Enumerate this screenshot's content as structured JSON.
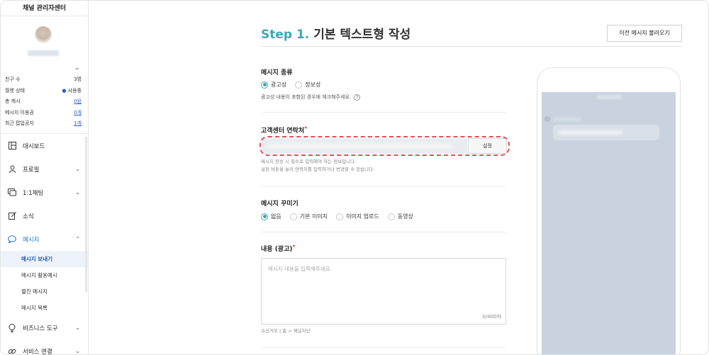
{
  "sidebar": {
    "title": "채널 관리자센터",
    "stats": [
      {
        "label": "친구 수",
        "value": "3명",
        "style": "plain"
      },
      {
        "label": "월렛 상태",
        "value": "사용중",
        "style": "dot"
      },
      {
        "label": "총 캐시",
        "value": "0원",
        "style": "link"
      },
      {
        "label": "메시지 이용권",
        "value": "0개",
        "style": "link"
      },
      {
        "label": "최근 팝업공지",
        "value": "1개",
        "style": "link"
      }
    ],
    "menu": {
      "dashboard": "대시보드",
      "profile": "프로필",
      "chat": "1:1채팅",
      "news": "소식",
      "message": "메시지",
      "business_tools": "비즈니스 도구",
      "service_connect": "서비스 연결"
    },
    "submenu": {
      "send": "메시지 보내기",
      "examples": "메시지 활용예시",
      "wide": "펼친 메시지",
      "list": "메시지 목록"
    },
    "colors": {
      "active": "#1976d2",
      "selected_bg": "#eef3fb"
    }
  },
  "main": {
    "step_label": "Step 1.",
    "title": "기본 텍스트형 작성",
    "load_prev_button": "이전 메시지 불러오기",
    "message_type": {
      "label": "메시지 종류",
      "options": [
        "광고성",
        "정보성"
      ],
      "selected": "광고성",
      "hint": "광고성 내용이 포함된 경우에 체크해주세요.",
      "hint_icon": "?"
    },
    "contact": {
      "label": "고객센터 연락처",
      "required_mark": "*",
      "button": "설정",
      "note_line1": "메시지 전송 시 필수로 입력해야 하는 정보입니다.",
      "note_line2": "설정 버튼을 눌러 연락처를 입력하거나 변경할 수 있습니다."
    },
    "decoration": {
      "label": "메시지 꾸미기",
      "options": [
        "없음",
        "기본 이미지",
        "이미지 업로드",
        "동영상"
      ],
      "selected": "없음"
    },
    "content": {
      "label": "내용 (광고)",
      "required_mark": "*",
      "placeholder": "메시지 내용을 입력해주세요.",
      "counter": "0/400자",
      "footer_note": "수신거부 | 홈 > 채널차단"
    },
    "colors": {
      "accent": "#3fa6b3",
      "highlight_border": "#e0505a"
    }
  }
}
